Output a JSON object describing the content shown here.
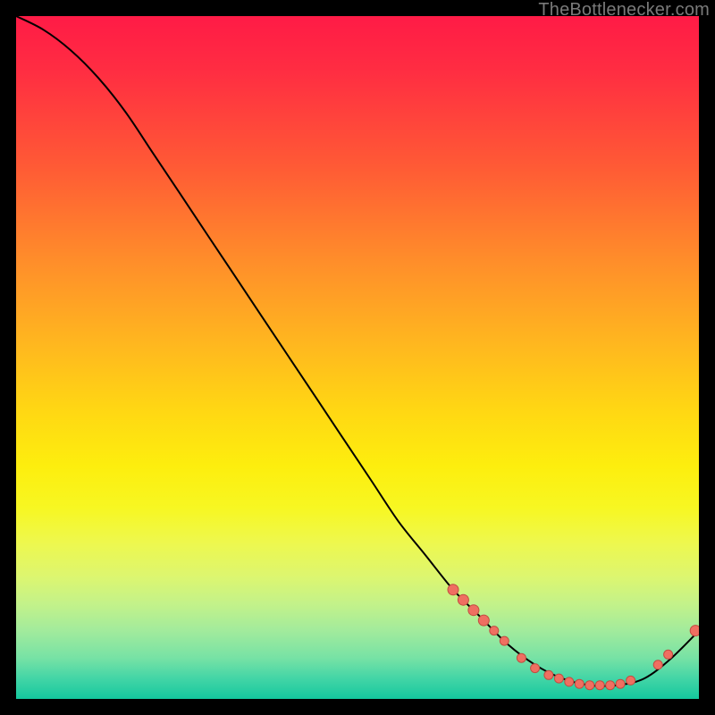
{
  "credit": "TheBottlenecker.com",
  "colors": {
    "dot_fill": "#ef6f61",
    "dot_stroke": "#c24d41",
    "curve": "#000000"
  },
  "chart_data": {
    "type": "line",
    "title": "",
    "xlabel": "",
    "ylabel": "",
    "xlim": [
      0,
      100
    ],
    "ylim": [
      0,
      100
    ],
    "grid": false,
    "legend": false,
    "series": [
      {
        "name": "bottleneck-curve",
        "x": [
          0,
          4,
          8,
          12,
          16,
          20,
          24,
          28,
          32,
          36,
          40,
          44,
          48,
          52,
          56,
          60,
          64,
          68,
          72,
          76,
          80,
          84,
          88,
          92,
          96,
          100
        ],
        "y": [
          100,
          98,
          95,
          91,
          86,
          80,
          74,
          68,
          62,
          56,
          50,
          44,
          38,
          32,
          26,
          21,
          16,
          12,
          8,
          5,
          3,
          2,
          2,
          3,
          6,
          10
        ]
      }
    ],
    "markers": [
      {
        "x": 64,
        "y": 16,
        "r": 6
      },
      {
        "x": 65.5,
        "y": 14.5,
        "r": 6
      },
      {
        "x": 67,
        "y": 13,
        "r": 6
      },
      {
        "x": 68.5,
        "y": 11.5,
        "r": 6
      },
      {
        "x": 70,
        "y": 10,
        "r": 5
      },
      {
        "x": 71.5,
        "y": 8.5,
        "r": 5
      },
      {
        "x": 74,
        "y": 6,
        "r": 5
      },
      {
        "x": 76,
        "y": 4.5,
        "r": 5
      },
      {
        "x": 78,
        "y": 3.5,
        "r": 5
      },
      {
        "x": 79.5,
        "y": 3,
        "r": 5
      },
      {
        "x": 81,
        "y": 2.5,
        "r": 5
      },
      {
        "x": 82.5,
        "y": 2.2,
        "r": 5
      },
      {
        "x": 84,
        "y": 2,
        "r": 5
      },
      {
        "x": 85.5,
        "y": 2,
        "r": 5
      },
      {
        "x": 87,
        "y": 2,
        "r": 5
      },
      {
        "x": 88.5,
        "y": 2.2,
        "r": 5
      },
      {
        "x": 90,
        "y": 2.7,
        "r": 5
      },
      {
        "x": 94,
        "y": 5,
        "r": 5
      },
      {
        "x": 95.5,
        "y": 6.5,
        "r": 5
      },
      {
        "x": 99.5,
        "y": 10,
        "r": 6
      }
    ]
  }
}
